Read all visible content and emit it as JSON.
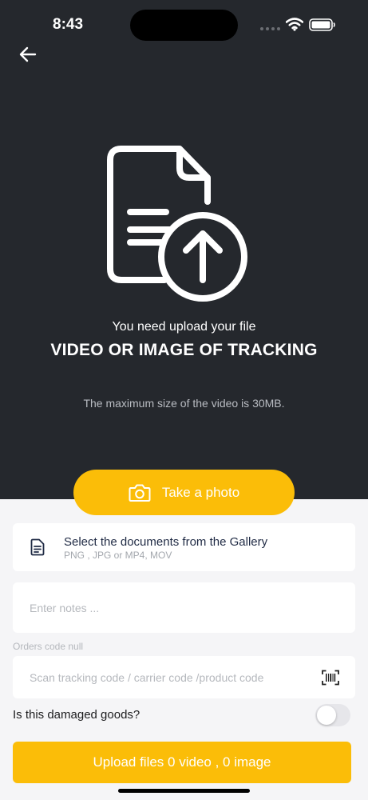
{
  "status_bar": {
    "time": "8:43"
  },
  "upload_hint": {
    "subtitle": "You need upload your file",
    "title": "VIDEO OR IMAGE OF TRACKING",
    "max_size": "The maximum size of the video is 30MB."
  },
  "photo_button": {
    "label": "Take a photo",
    "icon": "camera-icon"
  },
  "gallery": {
    "title": "Select the documents from the Gallery",
    "formats": "PNG , JPG or MP4, MOV",
    "icon": "document-icon"
  },
  "notes": {
    "placeholder": "Enter notes ..."
  },
  "orders_code": {
    "label": "Orders code null"
  },
  "scan": {
    "placeholder": "Scan tracking code / carrier code /product code",
    "icon": "barcode-icon"
  },
  "damaged": {
    "label": "Is this damaged goods?",
    "value": false
  },
  "upload_button": {
    "label": "Upload files 0 video , 0 image"
  },
  "colors": {
    "dark_bg": "#25282d",
    "accent": "#fbbd08",
    "light_bg": "#f5f5f7"
  }
}
